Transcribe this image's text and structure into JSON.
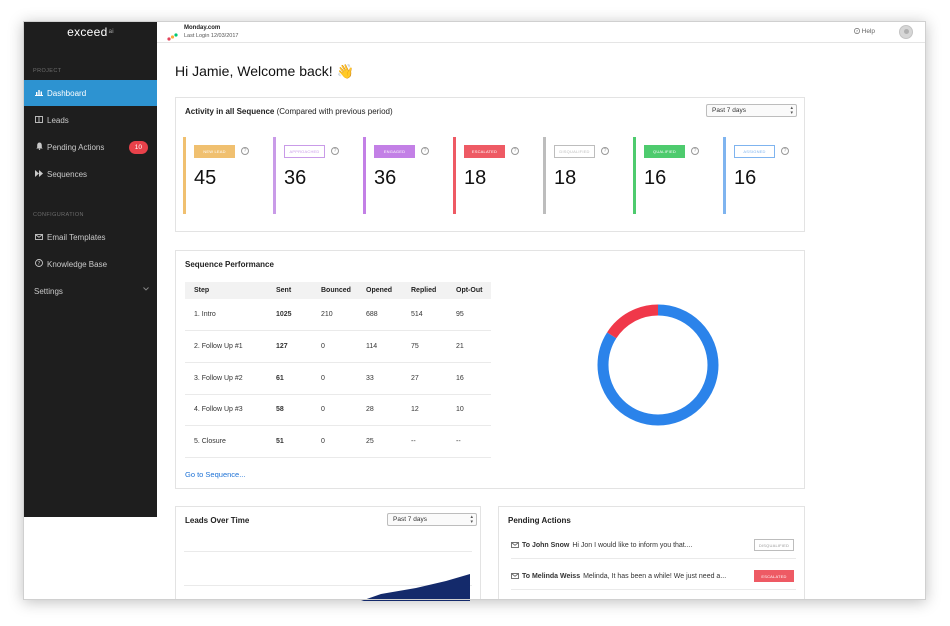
{
  "app": {
    "logo": "exceed",
    "logo_mark": "ai"
  },
  "sidebar": {
    "section_project": "PROJECT",
    "section_config": "CONFIGURATION",
    "items": [
      {
        "label": "Dashboard",
        "icon": "bar-chart-icon"
      },
      {
        "label": "Leads",
        "icon": "book-icon"
      },
      {
        "label": "Pending Actions",
        "icon": "bell-icon",
        "badge": "10"
      },
      {
        "label": "Sequences",
        "icon": "fast-forward-icon"
      },
      {
        "label": "Email Templates",
        "icon": "envelope-icon"
      },
      {
        "label": "Knowledge Base",
        "icon": "question-circle-icon"
      },
      {
        "label": "Settings",
        "icon": "chevron-down-icon"
      }
    ]
  },
  "topbar": {
    "company": "Monday.com",
    "last_login": "Last Login 12/03/2017",
    "help": "Help"
  },
  "greeting": "Hi Jamie, Welcome back! 👋",
  "activity": {
    "title_bold": "Activity in all Sequence",
    "title_rest": " (Compared with previous period)",
    "range": "Past 7 days",
    "stats": [
      {
        "label": "NEW LEAD",
        "value": "45",
        "color": "#f0c070",
        "style": "filled"
      },
      {
        "label": "APPROACHED",
        "value": "36",
        "color": "#c99be8",
        "style": "outline"
      },
      {
        "label": "ENGAGED",
        "value": "36",
        "color": "#c380e6",
        "style": "filled"
      },
      {
        "label": "ESCALATED",
        "value": "18",
        "color": "#ee5a64",
        "style": "filled"
      },
      {
        "label": "DISQUALIFIED",
        "value": "18",
        "color": "#bdbdbd",
        "style": "outline"
      },
      {
        "label": "QUALIFIED",
        "value": "16",
        "color": "#4ecb6e",
        "style": "filled"
      },
      {
        "label": "ASSIGNED",
        "value": "16",
        "color": "#7fb4ef",
        "style": "outline"
      }
    ]
  },
  "sequence": {
    "title": "Sequence Performance",
    "columns": [
      "Step",
      "Sent",
      "Bounced",
      "Opened",
      "Replied",
      "Opt-Out"
    ],
    "rows": [
      {
        "step": "1. Intro",
        "sent": "1025",
        "bounced": "210",
        "opened": "688",
        "replied": "514",
        "optout": "95"
      },
      {
        "step": "2. Follow Up #1",
        "sent": "127",
        "bounced": "0",
        "opened": "114",
        "replied": "75",
        "optout": "21"
      },
      {
        "step": "3. Follow Up #2",
        "sent": "61",
        "bounced": "0",
        "opened": "33",
        "replied": "27",
        "optout": "16"
      },
      {
        "step": "4. Follow Up #3",
        "sent": "58",
        "bounced": "0",
        "opened": "28",
        "replied": "12",
        "optout": "10"
      },
      {
        "step": "5. Closure",
        "sent": "51",
        "bounced": "0",
        "opened": "25",
        "replied": "--",
        "optout": "--"
      }
    ],
    "link": "Go to Sequence...",
    "donut": {
      "blue_share": 0.84,
      "red_share": 0.16,
      "blue": "#2b83ea",
      "red": "#f0384a"
    }
  },
  "leads_over_time": {
    "title": "Leads Over Time",
    "range": "Past 7 days",
    "fill": "#142a6b"
  },
  "pending_actions": {
    "title": "Pending Actions",
    "items": [
      {
        "to": "To John Snow",
        "text": "Hi Jon I would like to inform you that....",
        "badge": "DISQUALIFIED",
        "badge_style": "outline"
      },
      {
        "to": "To Melinda Weiss",
        "text": "Melinda, It has been a while! We just need a...",
        "badge": "ESCALATED",
        "badge_style": "filled"
      }
    ]
  }
}
